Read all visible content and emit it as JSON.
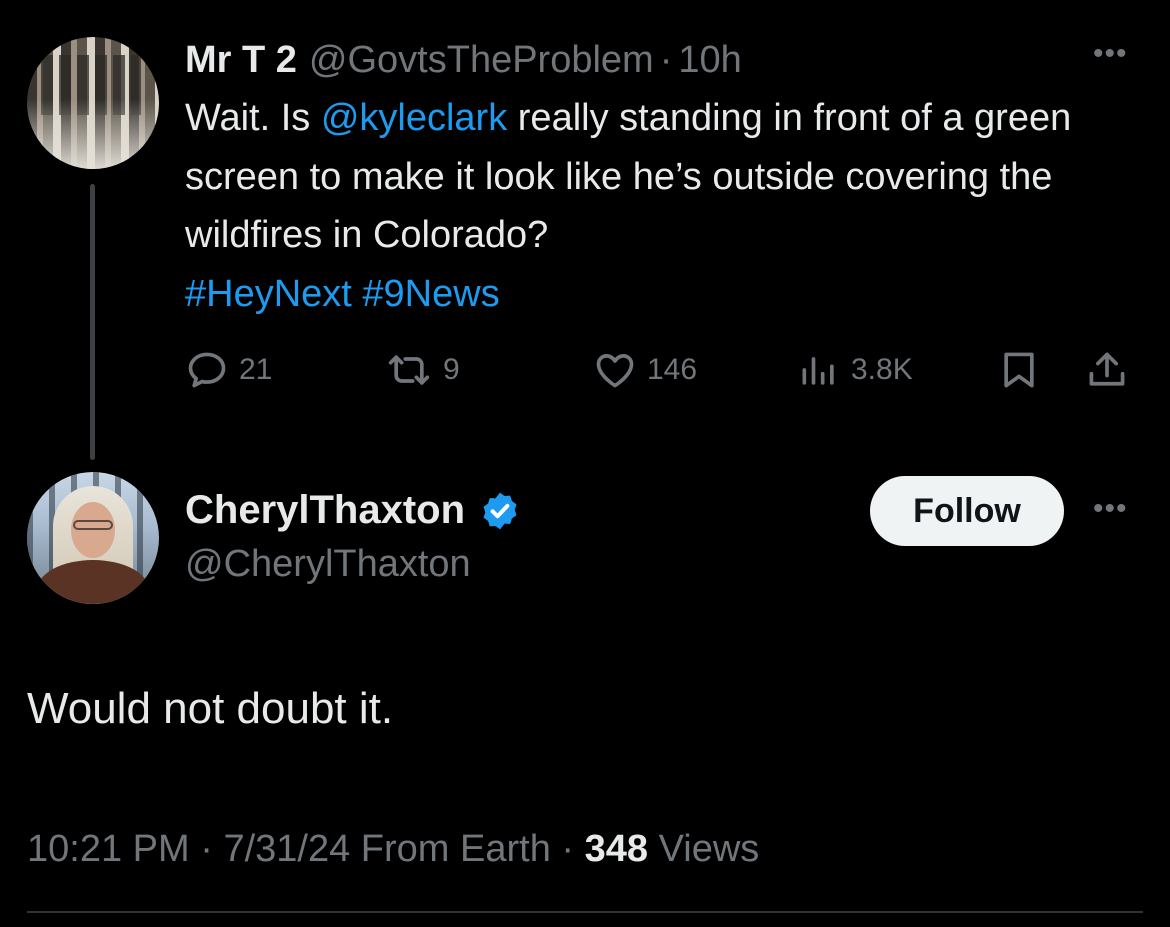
{
  "parent_tweet": {
    "display_name": "Mr T 2",
    "handle": "@GovtsTheProblem",
    "separator": "·",
    "time": "10h",
    "text_before_mention": "Wait. Is ",
    "mention": "@kyleclark",
    "text_after_mention": " really standing in front of a green screen to make it look like he’s outside covering the wildfires in Colorado?",
    "hashtags": [
      "#HeyNext",
      "#9News"
    ],
    "more_label": "•••",
    "counts": {
      "replies": "21",
      "reposts": "9",
      "likes": "146",
      "views": "3.8K"
    },
    "icons": [
      "reply-icon",
      "repost-icon",
      "like-icon",
      "views-icon",
      "bookmark-icon",
      "share-icon"
    ]
  },
  "reply_tweet": {
    "display_name": "CherylThaxton",
    "handle": "@CherylThaxton",
    "verified": true,
    "follow_label": "Follow",
    "more_label": "•••",
    "text": "Would not doubt it.",
    "time": "10:21 PM",
    "separator": "·",
    "date": "7/31/24",
    "source": "From Earth",
    "views_count": "348",
    "views_label": "Views"
  },
  "colors": {
    "background": "#000000",
    "text": "#e7e9ea",
    "secondary": "#71767b",
    "link": "#1d9bf0",
    "verified": "#1d9bf0",
    "follow_bg": "#eff3f4"
  }
}
